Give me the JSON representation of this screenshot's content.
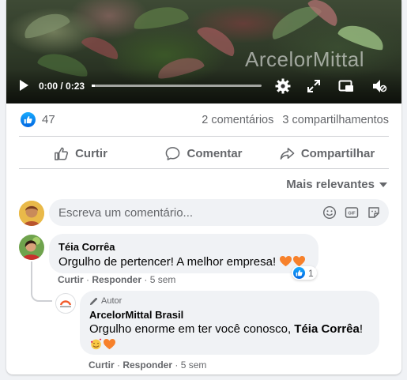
{
  "video": {
    "watermark": "ArcelorMittal",
    "time": "0:00 / 0:23",
    "progress_fraction": 0.02,
    "icons": [
      "play-icon",
      "settings-icon",
      "fullscreen-icon",
      "pip-icon",
      "volume-muted-icon"
    ]
  },
  "post": {
    "reaction_count": "47",
    "comments_count": "2 comentários",
    "shares_count": "3 compartilhamentos",
    "actions": {
      "like": "Curtir",
      "comment": "Comentar",
      "share": "Compartilhar"
    }
  },
  "sort": {
    "label": "Mais relevantes"
  },
  "compose": {
    "placeholder": "Escreva um comentário..."
  },
  "comments": [
    {
      "author": "Téia Corrêa",
      "text": "Orgulho de pertencer! A melhor empresa!",
      "like_label": "Curtir",
      "reply_label": "Responder",
      "time": "5 sem",
      "reaction_count": "1",
      "reply": {
        "badge": "Autor",
        "author": "ArcelorMittal Brasil",
        "text_prefix": "Orgulho enorme em ter você conosco,",
        "mention": "Téia Corrêa",
        "text_suffix": "!",
        "like_label": "Curtir",
        "reply_label": "Responder",
        "time": "5 sem"
      }
    }
  ],
  "colors": {
    "facebook_blue": "#0866ff",
    "secondary_text": "#65676b",
    "bubble_bg": "#f0f2f5",
    "heart_orange": "#f7812b"
  }
}
